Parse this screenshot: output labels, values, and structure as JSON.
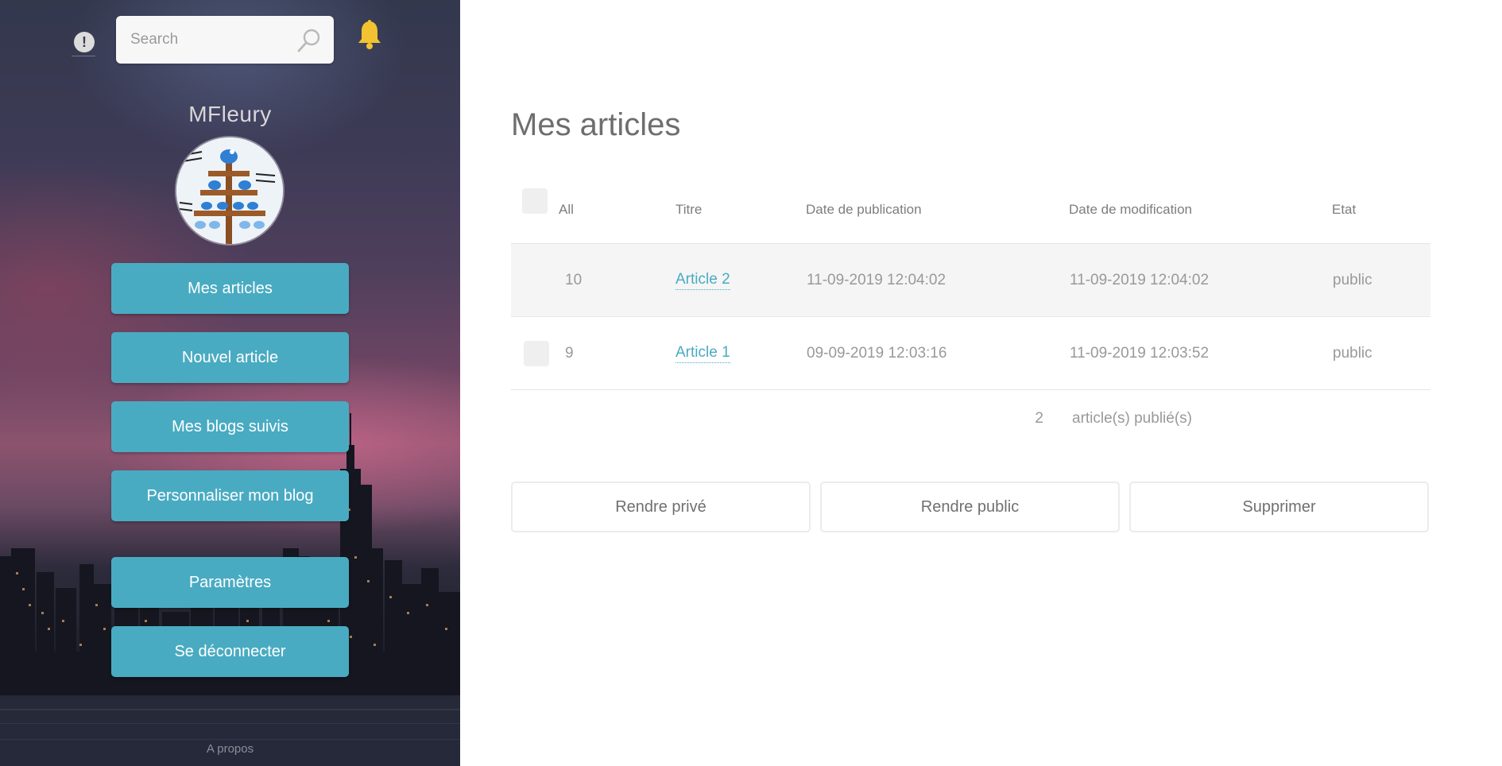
{
  "header": {
    "search_placeholder": "Search"
  },
  "sidebar": {
    "username": "MFleury",
    "nav": [
      {
        "label": "Mes articles"
      },
      {
        "label": "Nouvel article"
      },
      {
        "label": "Mes blogs suivis"
      },
      {
        "label": "Personnaliser mon blog"
      },
      {
        "label": "Paramètres"
      },
      {
        "label": "Se déconnecter"
      }
    ],
    "footer_link": "A propos",
    "accent_color": "#49abc2"
  },
  "main": {
    "title": "Mes articles",
    "table": {
      "columns": {
        "all": "All",
        "title": "Titre",
        "published": "Date de publication",
        "modified": "Date de modification",
        "state": "Etat"
      },
      "rows": [
        {
          "id": "10",
          "title": "Article 2",
          "published": "11-09-2019 12:04:02",
          "modified": "11-09-2019 12:04:02",
          "state": "public"
        },
        {
          "id": "9",
          "title": "Article 1",
          "published": "09-09-2019 12:03:16",
          "modified": "11-09-2019 12:03:52",
          "state": "public"
        }
      ],
      "summary_count": "2",
      "summary_label": "article(s) publié(s)"
    },
    "actions": {
      "make_private": "Rendre privé",
      "make_public": "Rendre public",
      "delete": "Supprimer"
    }
  }
}
